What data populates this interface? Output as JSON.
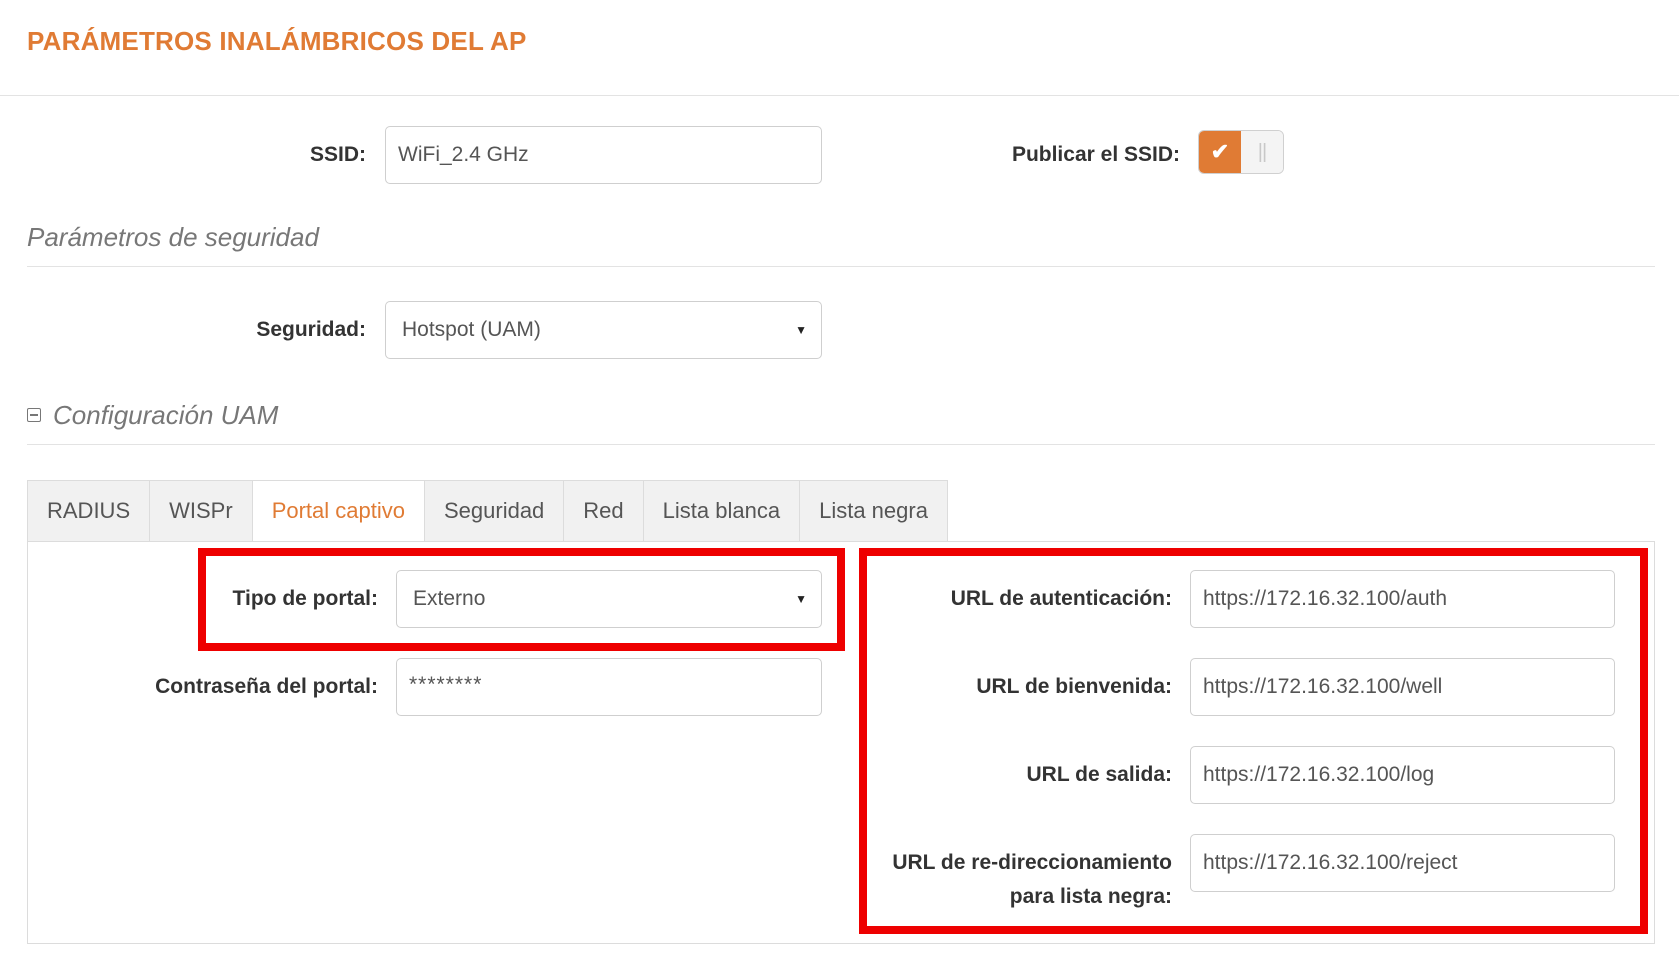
{
  "header": {
    "title": "PARÁMETROS INALÁMBRICOS DEL AP"
  },
  "ssid": {
    "label": "SSID:",
    "value": "WiFi_2.4 GHz"
  },
  "broadcast": {
    "label": "Publicar el SSID:",
    "checked": true
  },
  "security_section": {
    "title": "Parámetros de seguridad"
  },
  "security": {
    "label": "Seguridad:",
    "selected": "Hotspot (UAM)"
  },
  "uam_section": {
    "title": "Configuración UAM"
  },
  "tabs": [
    {
      "label": "RADIUS"
    },
    {
      "label": "WISPr"
    },
    {
      "label": "Portal captivo",
      "active": true
    },
    {
      "label": "Seguridad"
    },
    {
      "label": "Red"
    },
    {
      "label": "Lista blanca"
    },
    {
      "label": "Lista negra"
    }
  ],
  "portal": {
    "type_label": "Tipo de portal:",
    "type_selected": "Externo",
    "password_label": "Contraseña del portal:",
    "password_value": "********"
  },
  "urls": {
    "auth_label": "URL de autenticación:",
    "auth_value": "https://172.16.32.100/auth",
    "welcome_label": "URL de bienvenida:",
    "welcome_value": "https://172.16.32.100/well",
    "logout_label": "URL de salida:",
    "logout_value": "https://172.16.32.100/log",
    "redirect_label_line1": "URL de re-direccionamiento",
    "redirect_label_line2": "para lista negra:",
    "redirect_value": "https://172.16.32.100/reject"
  },
  "colors": {
    "accent": "#e07b34",
    "highlight": "#ee0000"
  }
}
